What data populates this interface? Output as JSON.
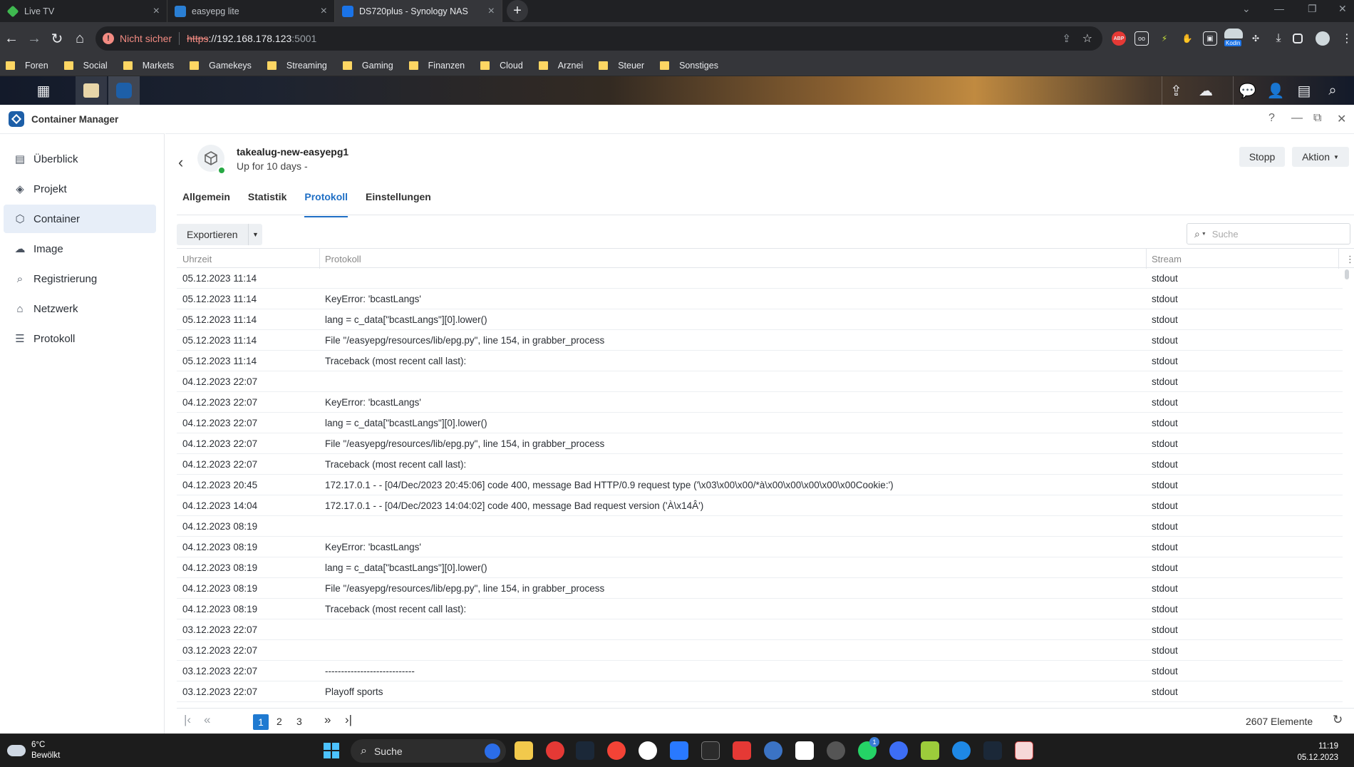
{
  "browser": {
    "tabs": [
      {
        "title": "Live TV",
        "active": false
      },
      {
        "title": "easyepg lite",
        "active": false
      },
      {
        "title": "DS720plus - Synology NAS",
        "active": true
      }
    ],
    "security_label": "Nicht sicher",
    "url_scheme": "https",
    "url_host": "://192.168.178.123",
    "url_port": ":5001",
    "bookmarks": [
      "Foren",
      "Social",
      "Markets",
      "Gamekeys",
      "Streaming",
      "Gaming",
      "Finanzen",
      "Cloud",
      "Arznei",
      "Steuer",
      "Sonstiges"
    ],
    "extension_badge": "Kodin",
    "abp_badge": "ABP"
  },
  "app": {
    "title": "Container Manager",
    "sidebar": [
      {
        "label": "Überblick",
        "icon": "overview-icon"
      },
      {
        "label": "Projekt",
        "icon": "project-icon"
      },
      {
        "label": "Container",
        "icon": "container-icon",
        "selected": true
      },
      {
        "label": "Image",
        "icon": "image-icon"
      },
      {
        "label": "Registrierung",
        "icon": "registry-icon"
      },
      {
        "label": "Netzwerk",
        "icon": "network-icon"
      },
      {
        "label": "Protokoll",
        "icon": "log-icon"
      }
    ],
    "container": {
      "name": "takealug-new-easyepg1",
      "status": "Up for 10 days -"
    },
    "buttons": {
      "stop": "Stopp",
      "action": "Aktion"
    },
    "tabs": [
      "Allgemein",
      "Statistik",
      "Protokoll",
      "Einstellungen"
    ],
    "active_tab": "Protokoll",
    "export_label": "Exportieren",
    "search_placeholder": "Suche",
    "columns": {
      "time": "Uhrzeit",
      "log": "Protokoll",
      "stream": "Stream"
    },
    "rows": [
      {
        "time": "05.12.2023 11:14",
        "log": "",
        "stream": "stdout"
      },
      {
        "time": "05.12.2023 11:14",
        "log": "KeyError: 'bcastLangs'",
        "stream": "stdout"
      },
      {
        "time": "05.12.2023 11:14",
        "log": "lang = c_data[\"bcastLangs\"][0].lower()",
        "stream": "stdout"
      },
      {
        "time": "05.12.2023 11:14",
        "log": "File \"/easyepg/resources/lib/epg.py\", line 154, in grabber_process",
        "stream": "stdout"
      },
      {
        "time": "05.12.2023 11:14",
        "log": "Traceback (most recent call last):",
        "stream": "stdout"
      },
      {
        "time": "04.12.2023 22:07",
        "log": "",
        "stream": "stdout"
      },
      {
        "time": "04.12.2023 22:07",
        "log": "KeyError: 'bcastLangs'",
        "stream": "stdout"
      },
      {
        "time": "04.12.2023 22:07",
        "log": "lang = c_data[\"bcastLangs\"][0].lower()",
        "stream": "stdout"
      },
      {
        "time": "04.12.2023 22:07",
        "log": "File \"/easyepg/resources/lib/epg.py\", line 154, in grabber_process",
        "stream": "stdout"
      },
      {
        "time": "04.12.2023 22:07",
        "log": "Traceback (most recent call last):",
        "stream": "stdout"
      },
      {
        "time": "04.12.2023 20:45",
        "log": "172.17.0.1 - - [04/Dec/2023 20:45:06] code 400, message Bad HTTP/0.9 request type ('\\x03\\x00\\x00/*à\\x00\\x00\\x00\\x00\\x00Cookie:')",
        "stream": "stdout"
      },
      {
        "time": "04.12.2023 14:04",
        "log": "172.17.0.1 - - [04/Dec/2023 14:04:02] code 400, message Bad request version ('À\\x14Â')",
        "stream": "stdout"
      },
      {
        "time": "04.12.2023 08:19",
        "log": "",
        "stream": "stdout"
      },
      {
        "time": "04.12.2023 08:19",
        "log": "KeyError: 'bcastLangs'",
        "stream": "stdout"
      },
      {
        "time": "04.12.2023 08:19",
        "log": "lang = c_data[\"bcastLangs\"][0].lower()",
        "stream": "stdout"
      },
      {
        "time": "04.12.2023 08:19",
        "log": "File \"/easyepg/resources/lib/epg.py\", line 154, in grabber_process",
        "stream": "stdout"
      },
      {
        "time": "04.12.2023 08:19",
        "log": "Traceback (most recent call last):",
        "stream": "stdout"
      },
      {
        "time": "03.12.2023 22:07",
        "log": "",
        "stream": "stdout"
      },
      {
        "time": "03.12.2023 22:07",
        "log": "",
        "stream": "stdout"
      },
      {
        "time": "03.12.2023 22:07",
        "log": "----------------------------",
        "stream": "stdout"
      },
      {
        "time": "03.12.2023 22:07",
        "log": "Playoff sports",
        "stream": "stdout"
      }
    ],
    "pagination": {
      "pages": [
        "1",
        "2",
        "3"
      ],
      "current": "1",
      "total": "2607 Elemente"
    }
  },
  "taskbar": {
    "temperature": "6°C",
    "weather": "Bewölkt",
    "search_label": "Suche",
    "time": "11:19",
    "date": "05.12.2023",
    "whatsapp_badge": "1"
  },
  "colors": {
    "accent": "#1f6fc5",
    "running": "#27a844",
    "browser_dark": "#202124"
  }
}
